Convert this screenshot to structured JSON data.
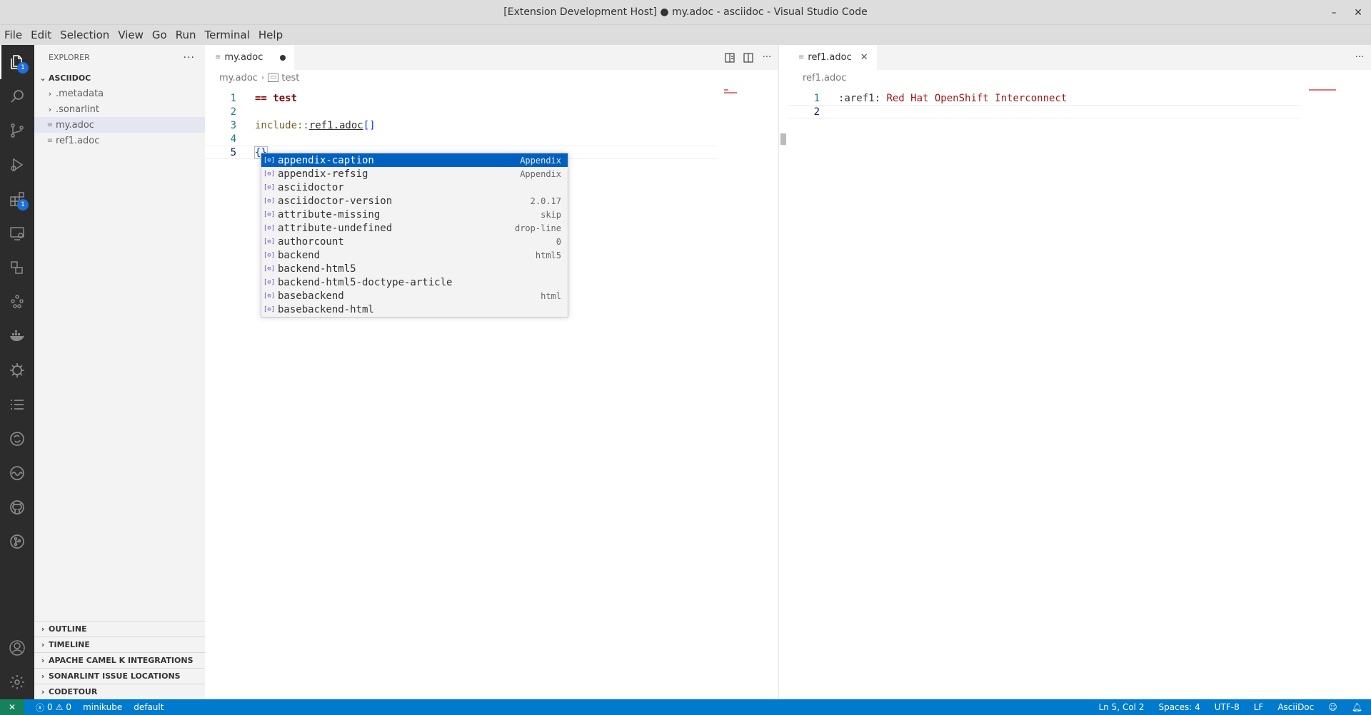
{
  "window": {
    "title": "[Extension Development Host] ● my.adoc - asciidoc - Visual Studio Code",
    "minimize": "–",
    "maximize": "□",
    "close": "✕"
  },
  "menu": [
    "File",
    "Edit",
    "Selection",
    "View",
    "Go",
    "Run",
    "Terminal",
    "Help"
  ],
  "activity": {
    "explorer_badge": "1",
    "extensions_badge": "1"
  },
  "sidebar": {
    "header": "EXPLORER",
    "more": "···",
    "folder": "ASCIIDOC",
    "items": [
      {
        "label": ".metadata",
        "type": "folder"
      },
      {
        "label": ".sonarlint",
        "type": "folder"
      },
      {
        "label": "my.adoc",
        "type": "file"
      },
      {
        "label": "ref1.adoc",
        "type": "file"
      }
    ],
    "sections": [
      "OUTLINE",
      "TIMELINE",
      "APACHE CAMEL K INTEGRATIONS",
      "SONARLINT ISSUE LOCATIONS",
      "CODETOUR"
    ]
  },
  "editor1": {
    "tab_label": "my.adoc",
    "breadcrumb_file": "my.adoc",
    "breadcrumb_symbol": "test",
    "lines": [
      {
        "n": "1",
        "text": "== test"
      },
      {
        "n": "2",
        "text": ""
      },
      {
        "n": "3",
        "kw": "include::",
        "ref": "ref1.adoc",
        "br": "[]"
      },
      {
        "n": "4",
        "text": ""
      },
      {
        "n": "5",
        "text": "{}"
      }
    ]
  },
  "suggest": [
    {
      "label": "appendix-caption",
      "detail": "Appendix"
    },
    {
      "label": "appendix-refsig",
      "detail": "Appendix"
    },
    {
      "label": "asciidoctor",
      "detail": ""
    },
    {
      "label": "asciidoctor-version",
      "detail": "2.0.17"
    },
    {
      "label": "attribute-missing",
      "detail": "skip"
    },
    {
      "label": "attribute-undefined",
      "detail": "drop-line"
    },
    {
      "label": "authorcount",
      "detail": "0"
    },
    {
      "label": "backend",
      "detail": "html5"
    },
    {
      "label": "backend-html5",
      "detail": ""
    },
    {
      "label": "backend-html5-doctype-article",
      "detail": ""
    },
    {
      "label": "basebackend",
      "detail": "html"
    },
    {
      "label": "basebackend-html",
      "detail": ""
    }
  ],
  "editor2": {
    "tab_label": "ref1.adoc",
    "breadcrumb_file": "ref1.adoc",
    "lines": [
      {
        "n": "1",
        "attr": ":aref1:",
        "val": " Red Hat OpenShift Interconnect"
      },
      {
        "n": "2",
        "text": ""
      }
    ]
  },
  "status": {
    "remote": "✕",
    "errors": "0",
    "warnings": "0",
    "kube": "minikube",
    "namespace": "default",
    "position": "Ln 5, Col 2",
    "spaces": "Spaces: 4",
    "encoding": "UTF-8",
    "eol": "LF",
    "language": "AsciiDoc"
  },
  "colors": {
    "accent": "#007acc",
    "selection": "#0060c0",
    "activitybar": "#2c2c2c"
  }
}
